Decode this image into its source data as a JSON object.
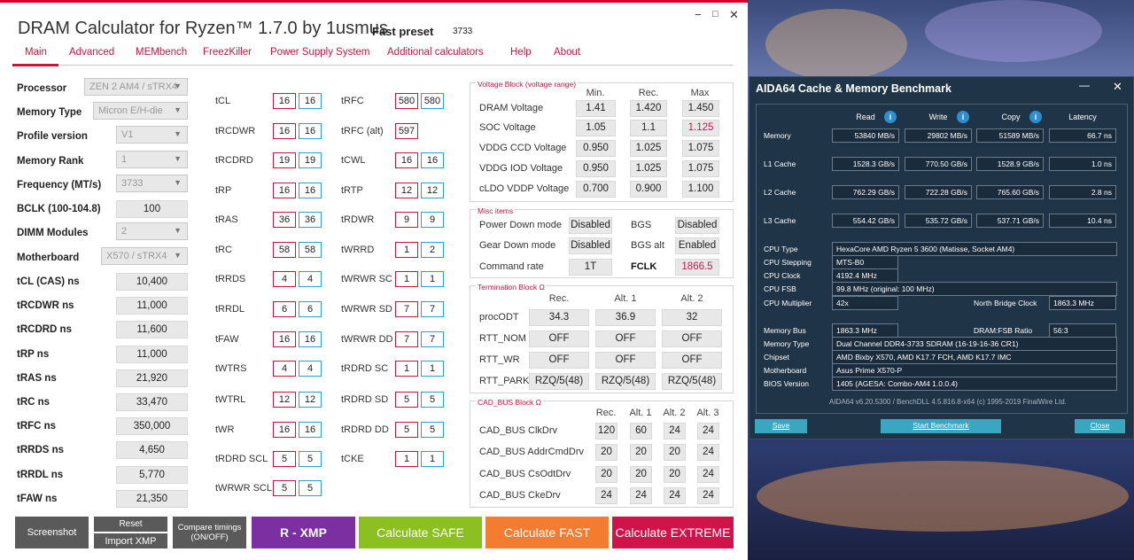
{
  "app": {
    "title": "DRAM Calculator for Ryzen™ 1.7.0 by 1usmus",
    "fast_preset_label": "Fast preset",
    "fast_preset_value": "3733",
    "min": "−",
    "max": "□",
    "close": "✕"
  },
  "tabs": [
    "Main",
    "Advanced",
    "MEMbench",
    "FreezKiller",
    "Power Supply System",
    "Additional calculators",
    "Help",
    "About"
  ],
  "left": [
    {
      "label": "Processor",
      "value": "ZEN 2 AM4 / sTRX4",
      "kind": "select"
    },
    {
      "label": "Memory Type",
      "value": "Micron E/H-die",
      "kind": "select"
    },
    {
      "label": "Profile version",
      "value": "V1",
      "kind": "select"
    },
    {
      "label": "Memory Rank",
      "value": "1",
      "kind": "select"
    },
    {
      "label": "Frequency (MT/s)",
      "value": "3733",
      "kind": "select"
    },
    {
      "label": "BCLK (100-104.8)",
      "value": "100",
      "kind": "value"
    },
    {
      "label": "DIMM Modules",
      "value": "2",
      "kind": "select"
    },
    {
      "label": "Motherboard",
      "value": "X570 / sTRX4",
      "kind": "select"
    },
    {
      "label": "tCL (CAS) ns",
      "value": "10,400",
      "kind": "value"
    },
    {
      "label": "tRCDWR ns",
      "value": "11,000",
      "kind": "value"
    },
    {
      "label": "tRCDRD ns",
      "value": "11,600",
      "kind": "value"
    },
    {
      "label": "tRP ns",
      "value": "11,000",
      "kind": "value"
    },
    {
      "label": "tRAS ns",
      "value": "21,920",
      "kind": "value"
    },
    {
      "label": "tRC ns",
      "value": "33,470",
      "kind": "value"
    },
    {
      "label": "tRFC ns",
      "value": "350,000",
      "kind": "value"
    },
    {
      "label": "tRRDS ns",
      "value": "4,650",
      "kind": "value"
    },
    {
      "label": "tRRDL ns",
      "value": "5,770",
      "kind": "value"
    },
    {
      "label": "tFAW ns",
      "value": "21,350",
      "kind": "value"
    }
  ],
  "timings1": [
    {
      "label": "tCL",
      "a": "16",
      "b": "16"
    },
    {
      "label": "tRCDWR",
      "a": "16",
      "b": "16"
    },
    {
      "label": "tRCDRD",
      "a": "19",
      "b": "19"
    },
    {
      "label": "tRP",
      "a": "16",
      "b": "16"
    },
    {
      "label": "tRAS",
      "a": "36",
      "b": "36"
    },
    {
      "label": "tRC",
      "a": "58",
      "b": "58"
    },
    {
      "label": "tRRDS",
      "a": "4",
      "b": "4"
    },
    {
      "label": "tRRDL",
      "a": "6",
      "b": "6"
    },
    {
      "label": "tFAW",
      "a": "16",
      "b": "16"
    },
    {
      "label": "tWTRS",
      "a": "4",
      "b": "4"
    },
    {
      "label": "tWTRL",
      "a": "12",
      "b": "12"
    },
    {
      "label": "tWR",
      "a": "16",
      "b": "16"
    },
    {
      "label": "tRDRD SCL",
      "a": "5",
      "b": "5"
    },
    {
      "label": "tWRWR SCL",
      "a": "5",
      "b": "5"
    }
  ],
  "timings2": [
    {
      "label": "tRFC",
      "a": "580",
      "b": "580"
    },
    {
      "label": "tRFC (alt)",
      "a": "597",
      "b": ""
    },
    {
      "label": "tCWL",
      "a": "16",
      "b": "16"
    },
    {
      "label": "tRTP",
      "a": "12",
      "b": "12"
    },
    {
      "label": "tRDWR",
      "a": "9",
      "b": "9"
    },
    {
      "label": "tWRRD",
      "a": "1",
      "b": "2"
    },
    {
      "label": "tWRWR SC",
      "a": "1",
      "b": "1"
    },
    {
      "label": "tWRWR SD",
      "a": "7",
      "b": "7"
    },
    {
      "label": "tWRWR DD",
      "a": "7",
      "b": "7"
    },
    {
      "label": "tRDRD SC",
      "a": "1",
      "b": "1"
    },
    {
      "label": "tRDRD SD",
      "a": "5",
      "b": "5"
    },
    {
      "label": "tRDRD DD",
      "a": "5",
      "b": "5"
    },
    {
      "label": "tCKE",
      "a": "1",
      "b": "1"
    }
  ],
  "voltage": {
    "title": "Voltage Block (voltage range)",
    "headers": [
      "Min.",
      "Rec.",
      "Max"
    ],
    "rows": [
      {
        "label": "DRAM Voltage",
        "min": "1.41",
        "rec": "1.420",
        "max": "1.450"
      },
      {
        "label": "SOC Voltage",
        "min": "1.05",
        "rec": "1.1",
        "max": "1.125"
      },
      {
        "label": "VDDG  CCD Voltage",
        "min": "0.950",
        "rec": "1.025",
        "max": "1.075"
      },
      {
        "label": "VDDG  IOD Voltage",
        "min": "0.950",
        "rec": "1.025",
        "max": "1.075"
      },
      {
        "label": "cLDO VDDP Voltage",
        "min": "0.700",
        "rec": "0.900",
        "max": "1.100"
      }
    ]
  },
  "misc": {
    "title": "Misc items",
    "rows": [
      {
        "l1": "Power Down mode",
        "v1": "Disabled",
        "l2": "BGS",
        "v2": "Disabled"
      },
      {
        "l1": "Gear Down mode",
        "v1": "Disabled",
        "l2": "BGS alt",
        "v2": "Enabled"
      },
      {
        "l1": "Command rate",
        "v1": "1T",
        "l2": "FCLK",
        "v2": "1866.5"
      }
    ]
  },
  "term": {
    "title": "Termination Block Ω",
    "headers": [
      "Rec.",
      "Alt. 1",
      "Alt. 2"
    ],
    "rows": [
      {
        "label": "procODT",
        "v": [
          "34.3",
          "36.9",
          "32"
        ]
      },
      {
        "label": "RTT_NOM",
        "v": [
          "OFF",
          "OFF",
          "OFF"
        ]
      },
      {
        "label": "RTT_WR",
        "v": [
          "OFF",
          "OFF",
          "OFF"
        ]
      },
      {
        "label": "RTT_PARK",
        "v": [
          "RZQ/5(48)",
          "RZQ/5(48)",
          "RZQ/5(48)"
        ]
      }
    ]
  },
  "cad": {
    "title": "CAD_BUS Block Ω",
    "headers": [
      "Rec.",
      "Alt. 1",
      "Alt. 2",
      "Alt. 3"
    ],
    "rows": [
      {
        "label": "CAD_BUS ClkDrv",
        "v": [
          "120",
          "60",
          "24",
          "24"
        ]
      },
      {
        "label": "CAD_BUS AddrCmdDrv",
        "v": [
          "20",
          "20",
          "20",
          "24"
        ]
      },
      {
        "label": "CAD_BUS CsOdtDrv",
        "v": [
          "20",
          "20",
          "20",
          "24"
        ]
      },
      {
        "label": "CAD_BUS CkeDrv",
        "v": [
          "24",
          "24",
          "24",
          "24"
        ]
      }
    ]
  },
  "buttons": {
    "screenshot": "Screenshot",
    "reset": "Reset",
    "import": "Import XMP",
    "compare": "Compare timings\n(ON/OFF)",
    "rxmp": "R - XMP",
    "safe": "Calculate SAFE",
    "fast": "Calculate FAST",
    "extreme": "Calculate EXTREME"
  },
  "aida": {
    "title": "AIDA64 Cache & Memory Benchmark",
    "min": "—",
    "close": "✕",
    "headers": [
      "Read",
      "Write",
      "Copy",
      "Latency"
    ],
    "rows": [
      {
        "label": "Memory",
        "v": [
          "53840 MB/s",
          "29802 MB/s",
          "51589 MB/s",
          "66.7 ns"
        ]
      },
      {
        "label": "L1 Cache",
        "v": [
          "1528.3 GB/s",
          "770.50 GB/s",
          "1528.9 GB/s",
          "1.0 ns"
        ]
      },
      {
        "label": "L2 Cache",
        "v": [
          "762.29 GB/s",
          "722.28 GB/s",
          "765.60 GB/s",
          "2.8 ns"
        ]
      },
      {
        "label": "L3 Cache",
        "v": [
          "554.42 GB/s",
          "535.72 GB/s",
          "537.71 GB/s",
          "10.4 ns"
        ]
      }
    ],
    "cpu_type_l": "CPU Type",
    "cpu_type": "HexaCore AMD Ryzen 5 3600  (Matisse, Socket AM4)",
    "cpu_step_l": "CPU Stepping",
    "cpu_step": "MTS-B0",
    "cpu_clock_l": "CPU Clock",
    "cpu_clock": "4192.4 MHz",
    "cpu_fsb_l": "CPU FSB",
    "cpu_fsb": "99.8 MHz  (original: 100 MHz)",
    "cpu_mult_l": "CPU Multiplier",
    "cpu_mult": "42x",
    "nb_l": "North Bridge Clock",
    "nb": "1863.3 MHz",
    "mem_bus_l": "Memory Bus",
    "mem_bus": "1863.3 MHz",
    "ratio_l": "DRAM:FSB Ratio",
    "ratio": "56:3",
    "mem_type_l": "Memory Type",
    "mem_type": "Dual Channel DDR4-3733 SDRAM  (16-19-16-36 CR1)",
    "chipset_l": "Chipset",
    "chipset": "AMD Bixby X570, AMD K17.7 FCH, AMD K17.7 IMC",
    "mb_l": "Motherboard",
    "mb": "Asus Prime X570-P",
    "bios_l": "BIOS Version",
    "bios": "1405  (AGESA: Combo-AM4 1.0.0.4)",
    "footer": "AIDA64 v6.20.5300 / BenchDLL 4.5.816.8-x64  (c) 1995-2019 FinalWire Ltd.",
    "save": "Save",
    "start": "Start Benchmark",
    "close_btn": "Close"
  }
}
